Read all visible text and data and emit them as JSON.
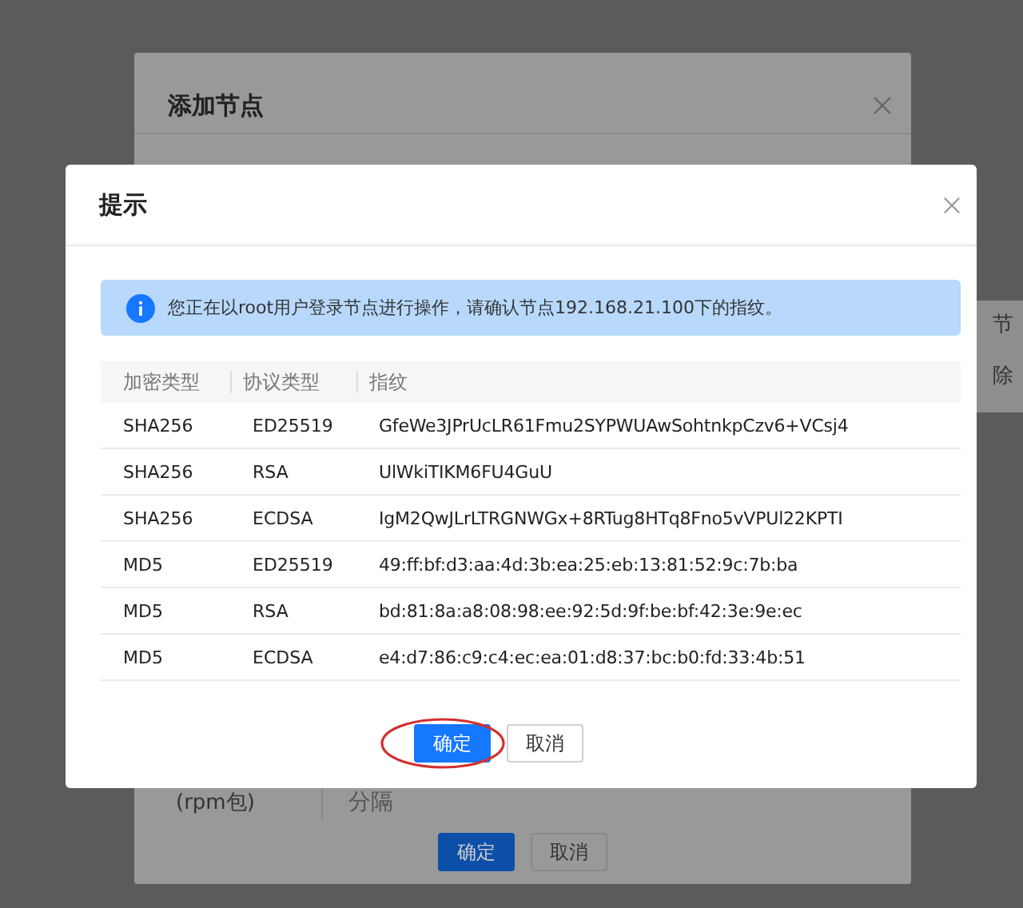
{
  "background_page": {
    "fragments": [
      "节",
      "除"
    ]
  },
  "back_dialog": {
    "title": "添加节点",
    "row": {
      "label": "(rpm包)",
      "value": "分隔"
    },
    "buttons": [
      {
        "label": "确定",
        "kind": "primary"
      },
      {
        "label": "取消",
        "kind": "default"
      }
    ]
  },
  "dialog": {
    "title": "提示",
    "alert": "您正在以root用户登录节点进行操作，请确认节点192.168.21.100下的指纹。",
    "table": {
      "columns": [
        "加密类型",
        "协议类型",
        "指纹"
      ],
      "rows": [
        [
          "SHA256",
          "ED25519",
          "GfeWe3JPrUcLR61Fmu2SYPWUAwSohtnkpCzv6+VCsj4"
        ],
        [
          "SHA256",
          "RSA",
          "UlWkiTIKM6FU4GuU"
        ],
        [
          "SHA256",
          "ECDSA",
          "IgM2QwJLrLTRGNWGx+8RTug8HTq8Fno5vVPUl22KPTI"
        ],
        [
          "MD5",
          "ED25519",
          "49:ff:bf:d3:aa:4d:3b:ea:25:eb:13:81:52:9c:7b:ba"
        ],
        [
          "MD5",
          "RSA",
          "bd:81:8a:a8:08:98:ee:92:5d:9f:be:bf:42:3e:9e:ec"
        ],
        [
          "MD5",
          "ECDSA",
          "e4:d7:86:c9:c4:ec:ea:01:d8:37:bc:b0:fd:33:4b:51"
        ]
      ]
    },
    "buttons": [
      {
        "label": "确定",
        "kind": "primary",
        "circled": true
      },
      {
        "label": "取消",
        "kind": "default",
        "circled": false
      }
    ]
  }
}
